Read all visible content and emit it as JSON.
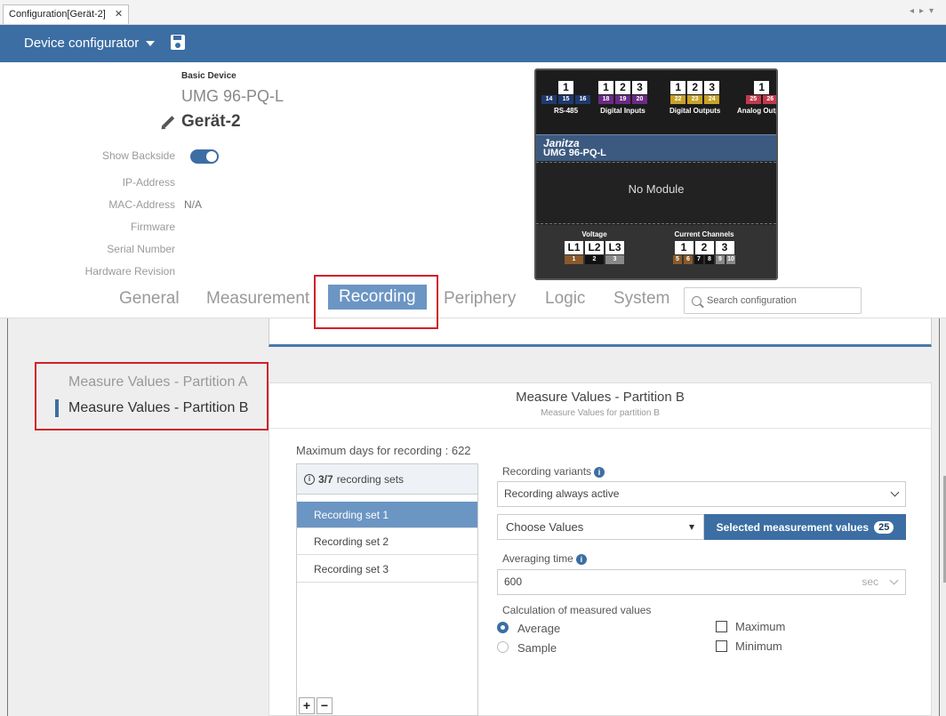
{
  "doc_tab": {
    "label": "Configuration[Gerät-2]",
    "close": "✕"
  },
  "header": {
    "title": "Device configurator"
  },
  "device": {
    "basic_label": "Basic Device",
    "model": "UMG 96-PQ-L",
    "name": "Gerät-2",
    "show_backside_label": "Show Backside",
    "show_backside_on": true,
    "ip_label": "IP-Address",
    "ip_value": "",
    "mac_label": "MAC-Address",
    "mac_value": "N/A",
    "firmware_label": "Firmware",
    "serial_label": "Serial Number",
    "hw_label": "Hardware Revision"
  },
  "graphic": {
    "groups": [
      {
        "label": "RS-485",
        "nums": [
          "1"
        ],
        "pins": [
          "14",
          "15",
          "16"
        ],
        "pin_colors": [
          "#1e3a6e",
          "#1e3a6e",
          "#1e3a6e"
        ]
      },
      {
        "label": "Digital Inputs",
        "nums": [
          "1",
          "2",
          "3"
        ],
        "pins": [
          "18",
          "19",
          "20"
        ],
        "pin_colors": [
          "#6a2a85",
          "#6a2a85",
          "#6a2a85"
        ]
      },
      {
        "label": "Digital Outputs",
        "nums": [
          "1",
          "2",
          "3"
        ],
        "pins": [
          "22",
          "23",
          "24"
        ],
        "pin_colors": [
          "#c9a227",
          "#c9a227",
          "#c9a227"
        ]
      },
      {
        "label": "Analog Output",
        "nums": [
          "1"
        ],
        "pins": [
          "25",
          "26"
        ],
        "pin_colors": [
          "#c0394b",
          "#c0394b"
        ]
      }
    ],
    "brand": "Janitza",
    "brand_model": "UMG 96-PQ-L",
    "no_module": "No Module",
    "voltage_label": "Voltage",
    "voltage_nums": [
      "L1",
      "L2",
      "L3"
    ],
    "voltage_pins": [
      "1",
      "2",
      "3"
    ],
    "voltage_colors": [
      "#8a5a2b",
      "#111111",
      "#888888"
    ],
    "current_label": "Current Channels",
    "current_nums": [
      "1",
      "2",
      "3"
    ],
    "current_pins": [
      "5",
      "6",
      "7",
      "8",
      "9",
      "10"
    ],
    "current_colors": [
      "#8a5a2b",
      "#8a5a2b",
      "#111111",
      "#111111",
      "#888888",
      "#888888"
    ]
  },
  "nav": {
    "tabs": [
      "General",
      "Measurement",
      "Recording",
      "Periphery",
      "Logic",
      "System"
    ],
    "active": "Recording",
    "search_placeholder": "Search configuration"
  },
  "sidebar": {
    "items": [
      "Measure Values - Partition A",
      "Measure Values - Partition B"
    ],
    "active": 1
  },
  "panel": {
    "title": "Measure Values - Partition B",
    "subtitle": "Measure Values for partition B",
    "max_days_label": "Maximum days for recording : 622",
    "sets_count": "3/7",
    "sets_suffix": "recording sets",
    "sets": [
      "Recording set 1",
      "Recording set 2",
      "Recording set 3"
    ],
    "selected_set": 0,
    "variants_label": "Recording variants",
    "variant_value": "Recording always active",
    "choose_values": "Choose Values",
    "selected_values_btn": "Selected measurement values",
    "selected_count": "25",
    "averaging_label": "Averaging time",
    "averaging_value": "600",
    "averaging_unit": "sec",
    "calc_label": "Calculation of measured values",
    "options": {
      "average": "Average",
      "sample": "Sample",
      "maximum": "Maximum",
      "minimum": "Minimum"
    },
    "selected_calc": "Average",
    "plus": "+",
    "minus": "−"
  },
  "colors": {
    "accent": "#3c6ea3",
    "highlight": "#d0202a",
    "selected_row": "#6b95c3"
  }
}
